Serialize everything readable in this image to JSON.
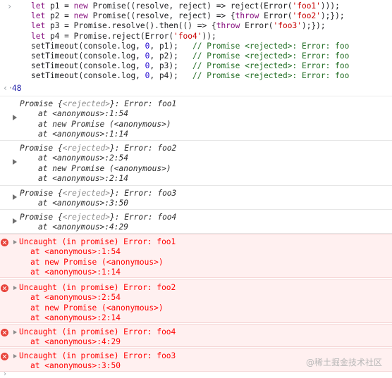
{
  "code": {
    "lines": [
      [
        [
          "k",
          "let"
        ],
        [
          "t",
          " p1 = "
        ],
        [
          "k",
          "new"
        ],
        [
          "t",
          " Promise((resolve, reject) => reject(Error("
        ],
        [
          "s",
          "'foo1'"
        ],
        [
          "t",
          ")));"
        ]
      ],
      [
        [
          "k",
          "let"
        ],
        [
          "t",
          " p2 = "
        ],
        [
          "k",
          "new"
        ],
        [
          "t",
          " Promise((resolve, reject) => {"
        ],
        [
          "k",
          "throw"
        ],
        [
          "t",
          " Error("
        ],
        [
          "s",
          "'foo2'"
        ],
        [
          "t",
          ");});"
        ]
      ],
      [
        [
          "k",
          "let"
        ],
        [
          "t",
          " p3 = Promise.resolve().then(() => {"
        ],
        [
          "k",
          "throw"
        ],
        [
          "t",
          " Error("
        ],
        [
          "s",
          "'foo3'"
        ],
        [
          "t",
          ");});"
        ]
      ],
      [
        [
          "k",
          "let"
        ],
        [
          "t",
          " p4 = Promise.reject(Error("
        ],
        [
          "s",
          "'foo4'"
        ],
        [
          "t",
          "));"
        ]
      ],
      [
        [
          "t",
          "setTimeout(console.log, "
        ],
        [
          "n",
          "0"
        ],
        [
          "t",
          ", p1);   "
        ],
        [
          "c",
          "// Promise <rejected>: Error: foo"
        ]
      ],
      [
        [
          "t",
          "setTimeout(console.log, "
        ],
        [
          "n",
          "0"
        ],
        [
          "t",
          ", p2);   "
        ],
        [
          "c",
          "// Promise <rejected>: Error: foo"
        ]
      ],
      [
        [
          "t",
          "setTimeout(console.log, "
        ],
        [
          "n",
          "0"
        ],
        [
          "t",
          ", p3);   "
        ],
        [
          "c",
          "// Promise <rejected>: Error: foo"
        ]
      ],
      [
        [
          "t",
          "setTimeout(console.log, "
        ],
        [
          "n",
          "0"
        ],
        [
          "t",
          ", p4);   "
        ],
        [
          "c",
          "// Promise <rejected>: Error: foo"
        ]
      ]
    ]
  },
  "return_value": "48",
  "logs": [
    {
      "head": [
        "Promise {",
        "<rejected>",
        "}: Error: foo1"
      ],
      "stack": [
        "at <anonymous>:1:54",
        "at new Promise (<anonymous>)",
        "at <anonymous>:1:14"
      ]
    },
    {
      "head": [
        "Promise {",
        "<rejected>",
        "}: Error: foo2"
      ],
      "stack": [
        "at <anonymous>:2:54",
        "at new Promise (<anonymous>)",
        "at <anonymous>:2:14"
      ]
    },
    {
      "head": [
        "Promise {",
        "<rejected>",
        "}: Error: foo3"
      ],
      "stack": [
        "at <anonymous>:3:50"
      ]
    },
    {
      "head": [
        "Promise {",
        "<rejected>",
        "}: Error: foo4"
      ],
      "stack": [
        "at <anonymous>:4:29"
      ]
    }
  ],
  "errors": [
    {
      "message": "Uncaught (in promise) Error: foo1",
      "stack": [
        "at <anonymous>:1:54",
        "at new Promise (<anonymous>)",
        "at <anonymous>:1:14"
      ]
    },
    {
      "message": "Uncaught (in promise) Error: foo2",
      "stack": [
        "at <anonymous>:2:54",
        "at new Promise (<anonymous>)",
        "at <anonymous>:2:14"
      ]
    },
    {
      "message": "Uncaught (in promise) Error: foo4",
      "stack": [
        "at <anonymous>:4:29"
      ]
    },
    {
      "message": "Uncaught (in promise) Error: foo3",
      "stack": [
        "at <anonymous>:3:50"
      ]
    }
  ],
  "watermark": "@稀土掘金技术社区",
  "colors": {
    "error_bg": "#fff0f0",
    "error_text": "#ff0000",
    "keyword": "#881280",
    "string": "#c80000",
    "number": "#1c00cf",
    "comment": "#236e25"
  }
}
